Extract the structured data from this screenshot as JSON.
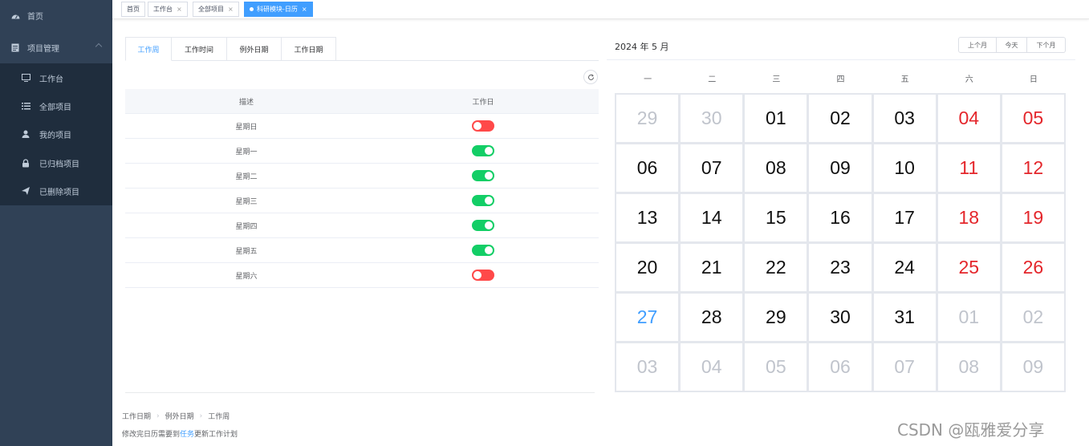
{
  "sidebar": {
    "top_items": [
      {
        "label": "首页",
        "icon": "dashboard-icon"
      },
      {
        "label": "项目管理",
        "icon": "project-icon"
      }
    ],
    "sub_items": [
      {
        "label": "工作台",
        "icon": "monitor-icon"
      },
      {
        "label": "全部项目",
        "icon": "list-icon"
      },
      {
        "label": "我的项目",
        "icon": "user-icon"
      },
      {
        "label": "已归档项目",
        "icon": "lock-icon"
      },
      {
        "label": "已删除项目",
        "icon": "send-icon"
      }
    ]
  },
  "tags": [
    {
      "label": "首页",
      "closable": false,
      "active": false
    },
    {
      "label": "工作台",
      "closable": true,
      "active": false
    },
    {
      "label": "全部项目",
      "closable": true,
      "active": false
    },
    {
      "label": "科研模块-日历",
      "closable": true,
      "active": true
    }
  ],
  "tabs": [
    "工作周",
    "工作时间",
    "例外日期",
    "工作日期"
  ],
  "table": {
    "headers": [
      "描述",
      "工作日"
    ],
    "rows": [
      {
        "label": "星期日",
        "working": false
      },
      {
        "label": "星期一",
        "working": true
      },
      {
        "label": "星期二",
        "working": true
      },
      {
        "label": "星期三",
        "working": true
      },
      {
        "label": "星期四",
        "working": true
      },
      {
        "label": "星期五",
        "working": true
      },
      {
        "label": "星期六",
        "working": false
      }
    ]
  },
  "breadcrumb": [
    "工作日期",
    "例外日期",
    "工作周"
  ],
  "hint": {
    "before": "修改完日历需要到",
    "link": "任务",
    "after": "更新工作计划"
  },
  "calendar": {
    "title": "2024 年 5 月",
    "buttons": [
      "上个月",
      "今天",
      "下个月"
    ],
    "weekdays": [
      "一",
      "二",
      "三",
      "四",
      "五",
      "六",
      "日"
    ],
    "days": [
      [
        "29",
        "30",
        "01",
        "02",
        "03",
        "04",
        "05"
      ],
      [
        "06",
        "07",
        "08",
        "09",
        "10",
        "11",
        "12"
      ],
      [
        "13",
        "14",
        "15",
        "16",
        "17",
        "18",
        "19"
      ],
      [
        "20",
        "21",
        "22",
        "23",
        "24",
        "25",
        "26"
      ],
      [
        "27",
        "28",
        "29",
        "30",
        "31",
        "01",
        "02"
      ],
      [
        "03",
        "04",
        "05",
        "06",
        "07",
        "08",
        "09"
      ]
    ],
    "today": "27",
    "colors": {
      "weekend": "#e4262b",
      "other_month": "#c0c4cc",
      "today": "#409eff",
      "normal": "#111111"
    }
  },
  "watermark": "CSDN @瓯雅爱分享"
}
